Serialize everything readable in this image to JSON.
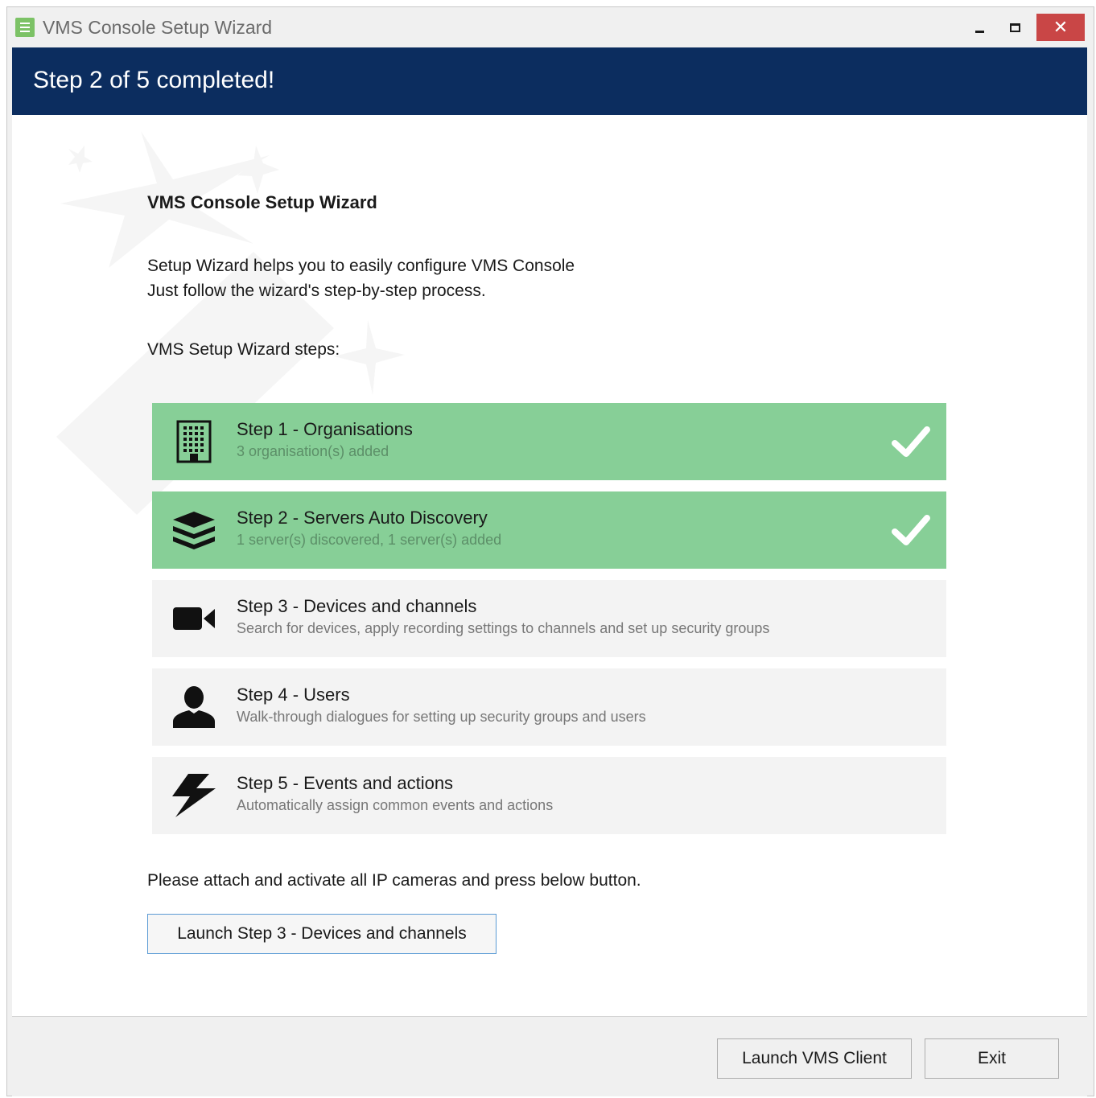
{
  "window": {
    "title": "VMS Console Setup Wizard",
    "controls": {
      "minimize": "minimize-icon",
      "maximize": "maximize-icon",
      "close": "✕"
    }
  },
  "banner": {
    "title": "Step 2 of 5 completed!"
  },
  "main": {
    "heading": "VMS Console Setup Wizard",
    "intro_line1": "Setup Wizard helps you to easily configure VMS Console",
    "intro_line2": "Just follow the wizard's step-by-step process.",
    "steps_label": "VMS Setup Wizard steps:",
    "steps": [
      {
        "title": "Step 1 - Organisations",
        "description": "3 organisation(s) added",
        "icon": "building-icon",
        "completed": true
      },
      {
        "title": "Step 2 - Servers Auto Discovery",
        "description": "1 server(s) discovered, 1 server(s) added",
        "icon": "servers-stack-icon",
        "completed": true
      },
      {
        "title": "Step 3 - Devices and channels",
        "description": "Search for devices, apply recording settings to channels and set up security groups",
        "icon": "video-camera-icon",
        "completed": false
      },
      {
        "title": "Step 4 - Users",
        "description": "Walk-through dialogues for setting up security groups and users",
        "icon": "user-icon",
        "completed": false
      },
      {
        "title": "Step 5 - Events and actions",
        "description": "Automatically assign common events and actions",
        "icon": "lightning-icon",
        "completed": false
      }
    ],
    "attach_text": "Please attach and activate all IP cameras and press below button.",
    "launch_step_button": "Launch Step 3 - Devices and channels"
  },
  "footer": {
    "launch_client_button": "Launch VMS Client",
    "exit_button": "Exit"
  },
  "colors": {
    "banner": "#0c2d5f",
    "completed_step": "#87cf97",
    "pending_step": "#f3f3f3",
    "close_button": "#c94646",
    "focus_border": "#5b9bd5"
  }
}
